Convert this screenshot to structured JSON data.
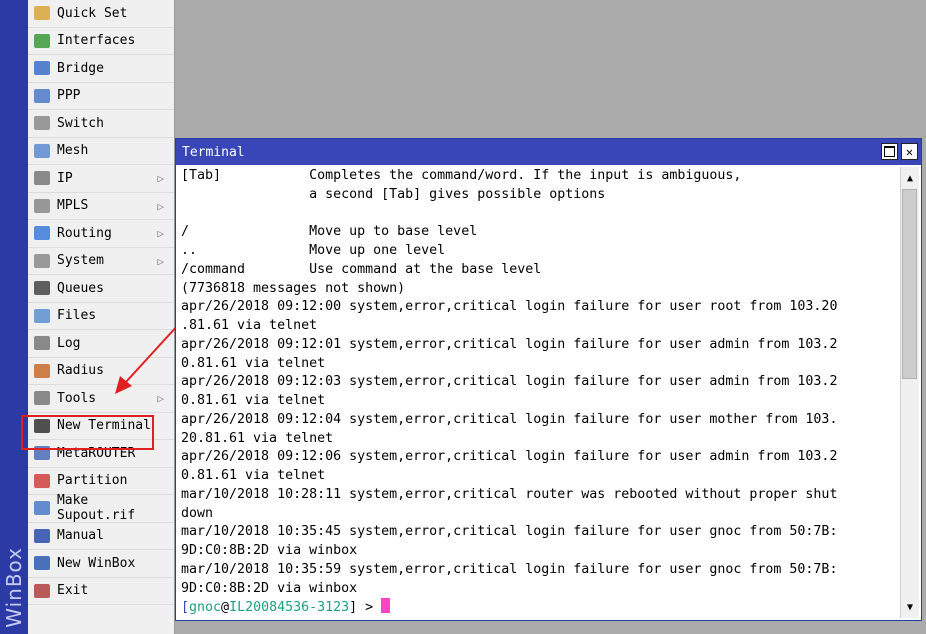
{
  "app": {
    "brand": "WinBox"
  },
  "menu": {
    "items": [
      {
        "label": "Quick Set",
        "icon": "quick-set-icon",
        "submenu": false
      },
      {
        "label": "Interfaces",
        "icon": "interfaces-icon",
        "submenu": false
      },
      {
        "label": "Bridge",
        "icon": "bridge-icon",
        "submenu": false
      },
      {
        "label": "PPP",
        "icon": "ppp-icon",
        "submenu": false
      },
      {
        "label": "Switch",
        "icon": "switch-icon",
        "submenu": false
      },
      {
        "label": "Mesh",
        "icon": "mesh-icon",
        "submenu": false
      },
      {
        "label": "IP",
        "icon": "ip-icon",
        "submenu": true
      },
      {
        "label": "MPLS",
        "icon": "mpls-icon",
        "submenu": true
      },
      {
        "label": "Routing",
        "icon": "routing-icon",
        "submenu": true
      },
      {
        "label": "System",
        "icon": "system-gear-icon",
        "submenu": true
      },
      {
        "label": "Queues",
        "icon": "queues-icon",
        "submenu": false
      },
      {
        "label": "Files",
        "icon": "folder-icon",
        "submenu": false
      },
      {
        "label": "Log",
        "icon": "log-icon",
        "submenu": false
      },
      {
        "label": "Radius",
        "icon": "radius-icon",
        "submenu": false
      },
      {
        "label": "Tools",
        "icon": "tools-icon",
        "submenu": true
      },
      {
        "label": "New Terminal",
        "icon": "terminal-icon",
        "submenu": false
      },
      {
        "label": "MetaROUTER",
        "icon": "metarouter-icon",
        "submenu": false
      },
      {
        "label": "Partition",
        "icon": "partition-icon",
        "submenu": false
      },
      {
        "label": "Make Supout.rif",
        "icon": "supout-icon",
        "submenu": false
      },
      {
        "label": "Manual",
        "icon": "help-icon",
        "submenu": false
      },
      {
        "label": "New WinBox",
        "icon": "winbox-icon",
        "submenu": false
      },
      {
        "label": "Exit",
        "icon": "exit-icon",
        "submenu": false
      }
    ]
  },
  "terminal": {
    "title": "Terminal",
    "lines": [
      "[Tab]           Completes the command/word. If the input is ambiguous,",
      "                a second [Tab] gives possible options",
      "",
      "/               Move up to base level",
      "..              Move up one level",
      "/command        Use command at the base level",
      "(7736818 messages not shown)",
      "apr/26/2018 09:12:00 system,error,critical login failure for user root from 103.20",
      ".81.61 via telnet",
      "apr/26/2018 09:12:01 system,error,critical login failure for user admin from 103.2",
      "0.81.61 via telnet",
      "apr/26/2018 09:12:03 system,error,critical login failure for user admin from 103.2",
      "0.81.61 via telnet",
      "apr/26/2018 09:12:04 system,error,critical login failure for user mother from 103.",
      "20.81.61 via telnet",
      "apr/26/2018 09:12:06 system,error,critical login failure for user admin from 103.2",
      "0.81.61 via telnet",
      "mar/10/2018 10:28:11 system,error,critical router was rebooted without proper shut",
      "down",
      "mar/10/2018 10:35:45 system,error,critical login failure for user gnoc from 50:7B:",
      "9D:C0:8B:2D via winbox",
      "mar/10/2018 10:35:59 system,error,critical login failure for user gnoc from 50:7B:",
      "9D:C0:8B:2D via winbox"
    ],
    "prompt": {
      "open": "[",
      "user": "gnoc",
      "at": "@",
      "host": "IL20084536-3123",
      "close": "] >"
    }
  },
  "colors": {
    "accent": "#3846b8",
    "highlight": "#e02020",
    "cursor": "#ff44c4"
  }
}
